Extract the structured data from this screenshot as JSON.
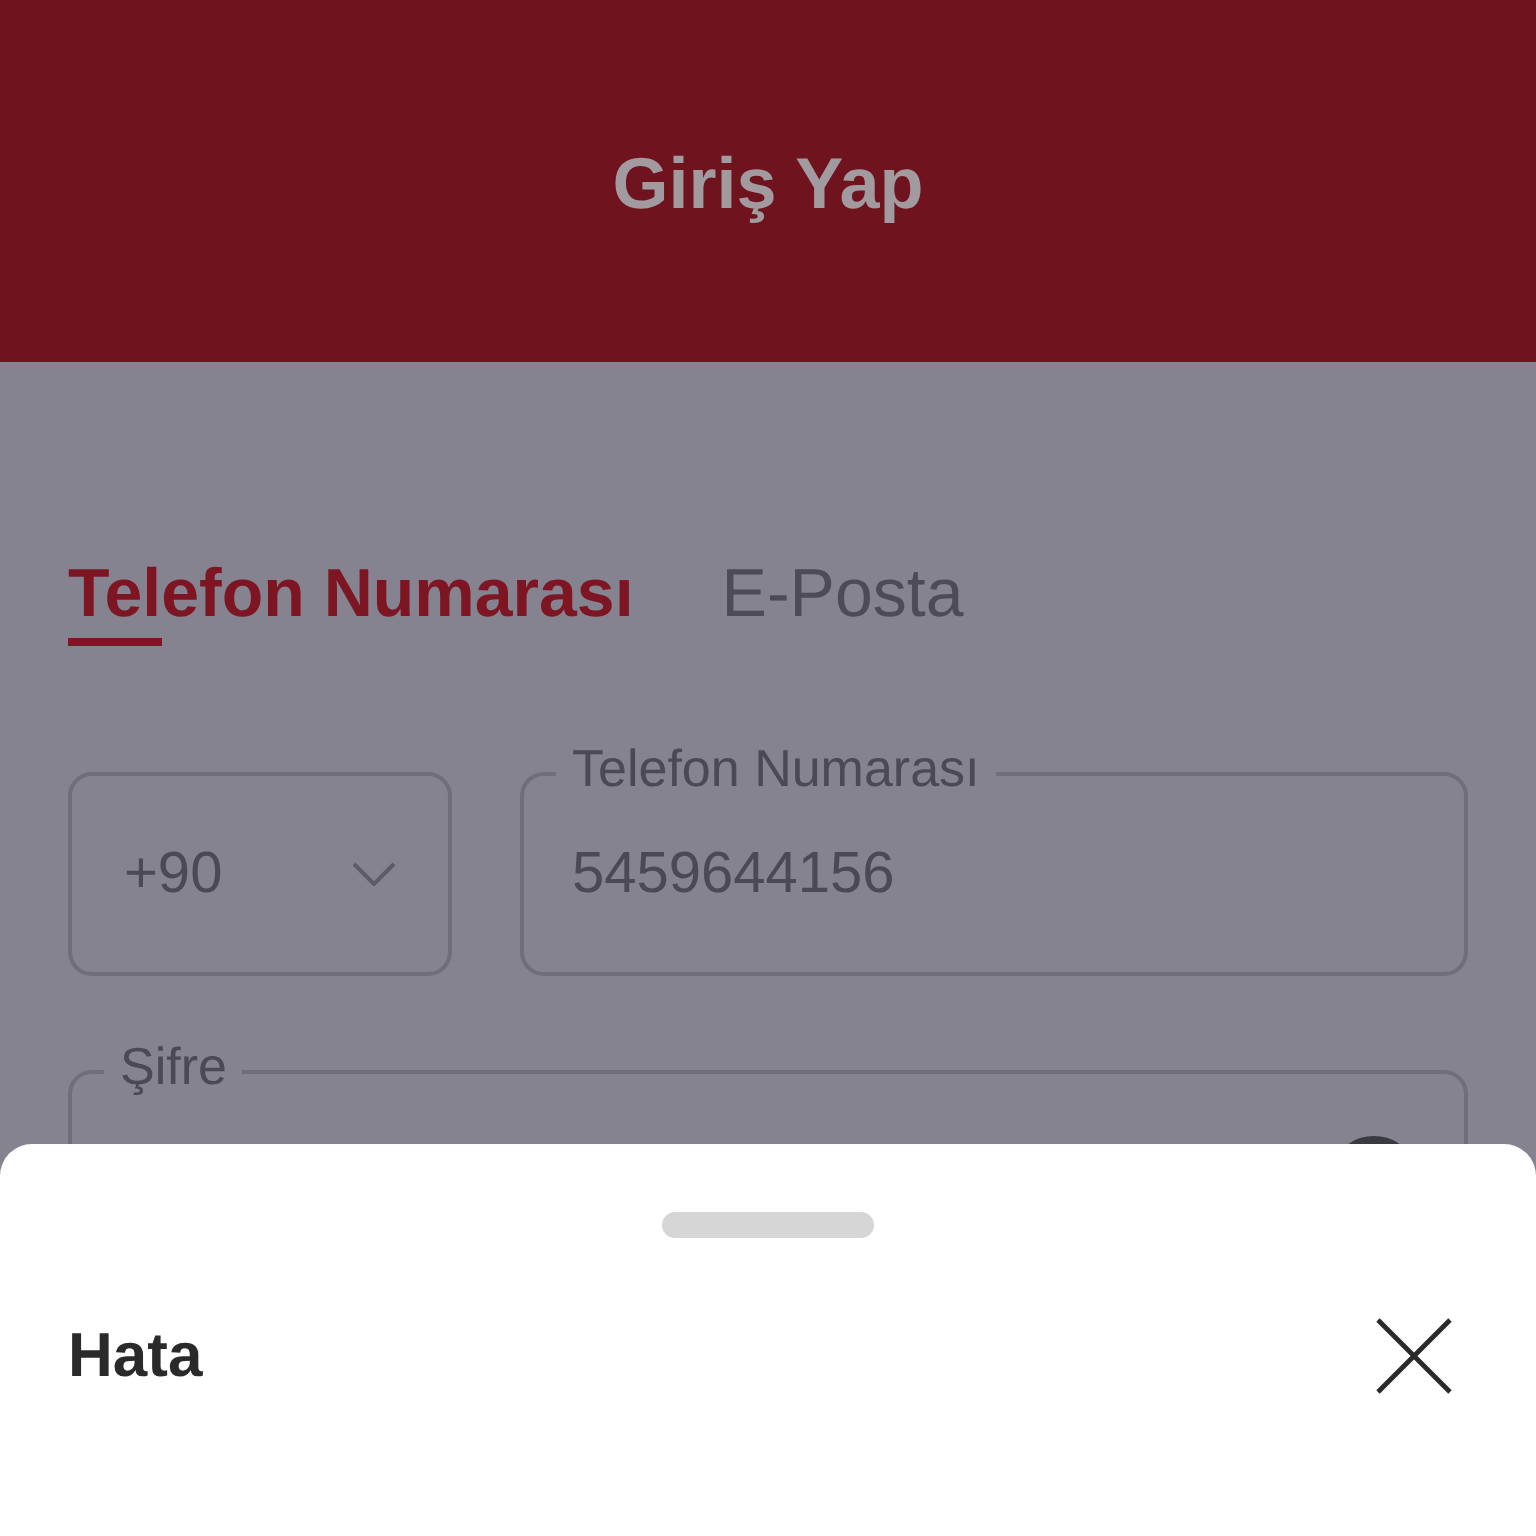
{
  "header": {
    "title": "Giriş Yap"
  },
  "tabs": [
    {
      "label": "Telefon Numarası",
      "selected": true
    },
    {
      "label": "E-Posta",
      "selected": false
    }
  ],
  "country_code": {
    "value": "+90"
  },
  "phone": {
    "label": "Telefon Numarası",
    "value": "5459644156"
  },
  "password": {
    "label": "Şifre"
  },
  "sheet": {
    "title": "Hata"
  }
}
